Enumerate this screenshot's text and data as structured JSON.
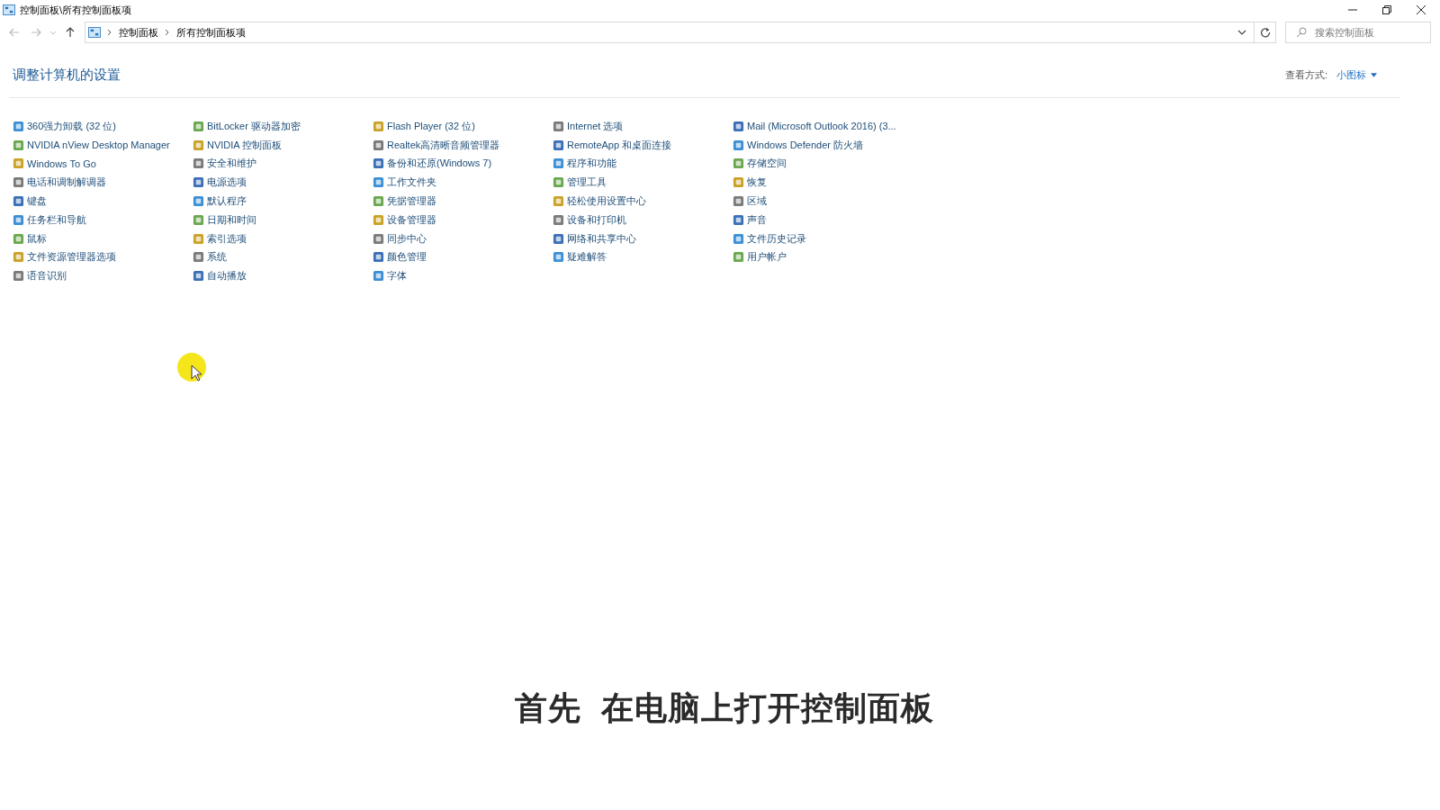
{
  "window": {
    "title": "控制面板\\所有控制面板项"
  },
  "address_bar": {
    "breadcrumbs": [
      "控制面板",
      "所有控制面板项"
    ]
  },
  "search": {
    "placeholder": "搜索控制面板"
  },
  "heading": "调整计算机的设置",
  "view_by": {
    "label": "查看方式:",
    "value": "小图标"
  },
  "columns": [
    [
      "360强力卸载 (32 位)",
      "NVIDIA nView Desktop Manager",
      "Windows To Go",
      "电话和调制解调器",
      "键盘",
      "任务栏和导航",
      "鼠标",
      "文件资源管理器选项",
      "语音识别"
    ],
    [
      "BitLocker 驱动器加密",
      "NVIDIA 控制面板",
      "安全和维护",
      "电源选项",
      "默认程序",
      "日期和时间",
      "索引选项",
      "系统",
      "自动播放"
    ],
    [
      "Flash Player (32 位)",
      "Realtek高清晰音频管理器",
      "备份和还原(Windows 7)",
      "工作文件夹",
      "凭据管理器",
      "设备管理器",
      "同步中心",
      "颜色管理",
      "字体"
    ],
    [
      "Internet 选项",
      "RemoteApp 和桌面连接",
      "程序和功能",
      "管理工具",
      "轻松使用设置中心",
      "设备和打印机",
      "网络和共享中心",
      "疑难解答"
    ],
    [
      "Mail (Microsoft Outlook 2016) (3...",
      "Windows Defender 防火墙",
      "存储空间",
      "恢复",
      "区域",
      "声音",
      "文件历史记录",
      "用户帐户"
    ]
  ],
  "caption": "首先  在电脑上打开控制面板"
}
